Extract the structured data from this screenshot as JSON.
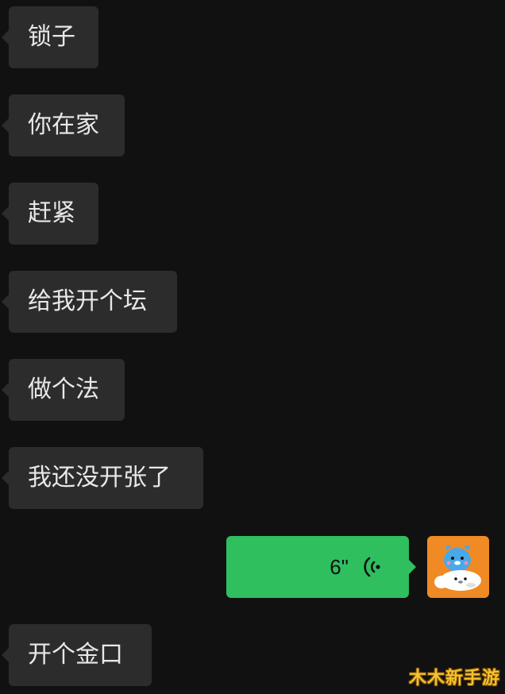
{
  "messages": [
    {
      "text": "锁子"
    },
    {
      "text": "你在家"
    },
    {
      "text": "赶紧"
    },
    {
      "text": "给我开个坛"
    },
    {
      "text": "做个法"
    },
    {
      "text": "我还没开张了"
    },
    {
      "text": "开个金口"
    }
  ],
  "voice_message": {
    "duration": "6\"",
    "icon": "voice-wave-icon"
  },
  "avatar": {
    "icon": "seal-cartoon-avatar"
  },
  "watermark": {
    "text": "木木新手游"
  },
  "colors": {
    "background": "#111111",
    "incoming_bubble": "#2c2c2c",
    "outgoing_bubble": "#2fbf5f",
    "avatar_bg": "#f08a24"
  }
}
